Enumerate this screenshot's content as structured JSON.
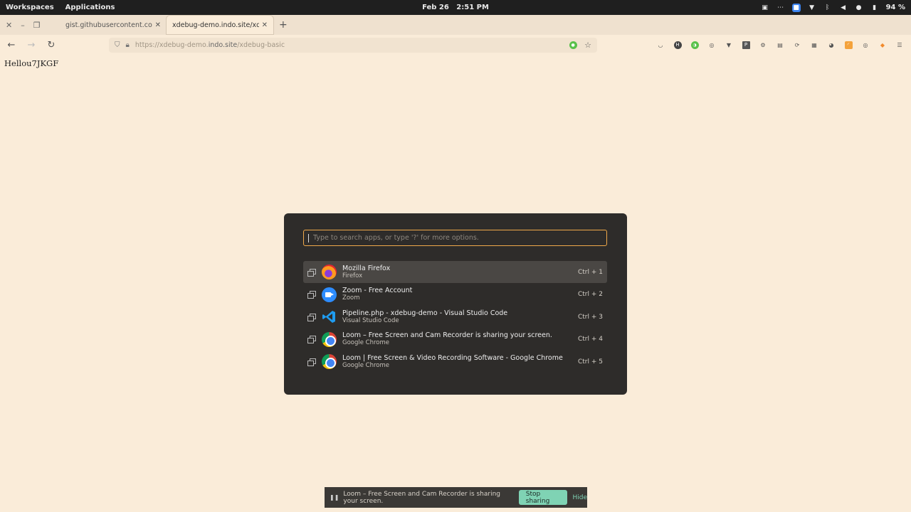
{
  "topbar": {
    "workspaces": "Workspaces",
    "applications": "Applications",
    "date": "Feb 26",
    "time": "2:51 PM",
    "battery": "94 %"
  },
  "tabs": [
    {
      "label": "gist.githubusercontent.com/ror",
      "active": false
    },
    {
      "label": "xdebug-demo.indo.site/xdebug",
      "active": true
    }
  ],
  "urlbar": {
    "prefix": "https://xdebug-demo.",
    "host": "indo.site",
    "path": "/xdebug-basic"
  },
  "page": {
    "text": "Hellou7JKGF"
  },
  "launcher": {
    "search_placeholder": "Type to search apps, or type '?' for more options.",
    "results": [
      {
        "title": "Mozilla Firefox",
        "subtitle": "Firefox",
        "shortcut": "Ctrl + 1",
        "icon": "firefox-icon"
      },
      {
        "title": "Zoom - Free Account",
        "subtitle": "Zoom",
        "shortcut": "Ctrl + 2",
        "icon": "zoom-icon"
      },
      {
        "title": "Pipeline.php - xdebug-demo - Visual Studio Code",
        "subtitle": "Visual Studio Code",
        "shortcut": "Ctrl + 3",
        "icon": "vscode-icon"
      },
      {
        "title": "Loom – Free Screen and Cam Recorder is sharing your screen.",
        "subtitle": "Google Chrome",
        "shortcut": "Ctrl + 4",
        "icon": "chrome-icon"
      },
      {
        "title": "Loom | Free Screen & Video Recording Software - Google Chrome",
        "subtitle": "Google Chrome",
        "shortcut": "Ctrl + 5",
        "icon": "chrome-icon"
      }
    ]
  },
  "sharebar": {
    "message": "Loom – Free Screen and Cam Recorder is sharing your screen.",
    "stop_label": "Stop sharing",
    "hide_label": "Hide"
  },
  "colors": {
    "page_bg": "#faecd9",
    "launcher_bg": "#2e2c2a",
    "search_border": "#f0a94a",
    "share_button": "#7fd3b4"
  }
}
